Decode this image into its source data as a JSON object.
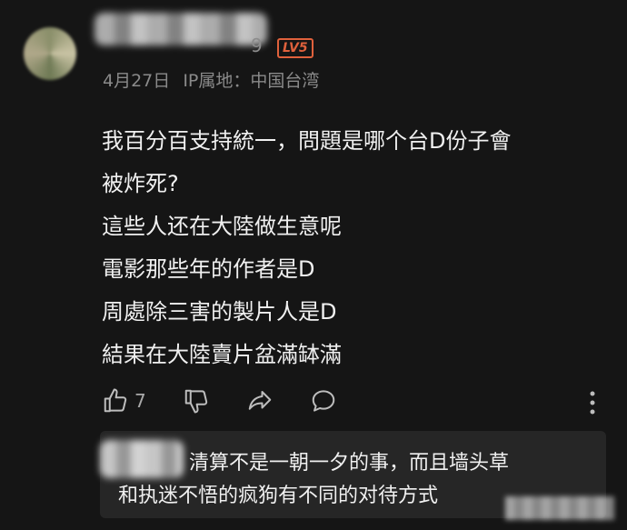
{
  "comment": {
    "username_visible_tail": "9",
    "level_badge": "LV5",
    "date": "4月27日",
    "ip_location": "IP属地：中国台湾",
    "body_lines": [
      "我百分百支持統一，問題是哪个台D份子會",
      "被炸死?",
      "這些人还在大陸做生意呢",
      "電影那些年的作者是D",
      "周處除三害的製片人是D",
      "結果在大陸賣片盆滿缽滿"
    ],
    "like_count": "7"
  },
  "reply": {
    "text_line1": "清算不是一朝一夕的事，而且墙头草",
    "text_line2": "和执迷不悟的疯狗有不同的对待方式"
  },
  "colors": {
    "background": "#151515",
    "reply_background": "#262626",
    "badge": "#e0613c",
    "meta_text": "#8a8a8a"
  },
  "icons": [
    "thumbs-up-icon",
    "thumbs-down-icon",
    "share-icon",
    "comment-icon",
    "more-vertical-icon"
  ]
}
